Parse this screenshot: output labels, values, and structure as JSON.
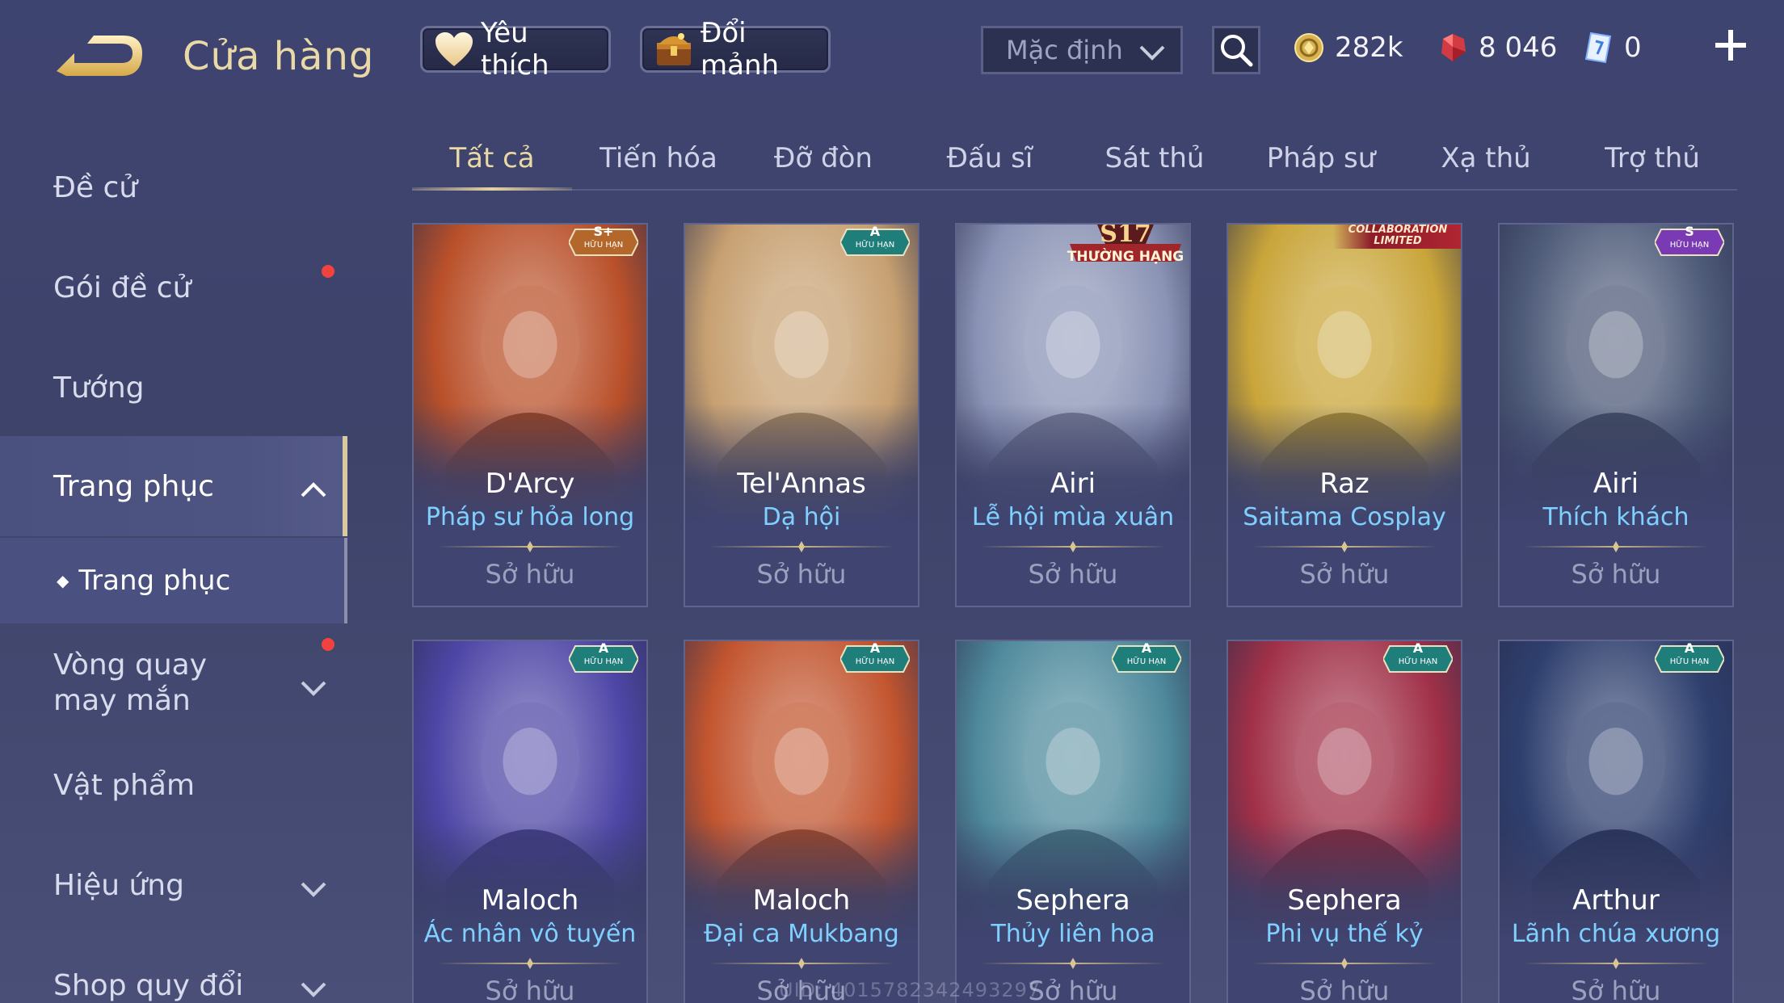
{
  "header": {
    "title": "Cửa hàng",
    "favorites_label": "Yêu thích",
    "exchange_label": "Đổi mảnh",
    "sort_selected": "Mặc định",
    "currency": {
      "gold": "282k",
      "ruby": "8 046",
      "voucher": "0"
    }
  },
  "sidebar": {
    "items": [
      {
        "label": "Đề cử"
      },
      {
        "label": "Gói đề cử"
      },
      {
        "label": "Tướng"
      },
      {
        "label": "Trang phục"
      },
      {
        "label": "Trang phục"
      },
      {
        "label": "Vòng quay may mắn"
      },
      {
        "label": "Vật phẩm"
      },
      {
        "label": "Hiệu ứng"
      },
      {
        "label": "Shop quy đổi"
      }
    ]
  },
  "tabs": [
    {
      "label": "Tất cả"
    },
    {
      "label": "Tiến hóa"
    },
    {
      "label": "Đỡ đòn"
    },
    {
      "label": "Đấu sĩ"
    },
    {
      "label": "Sát thủ"
    },
    {
      "label": "Pháp sư"
    },
    {
      "label": "Xạ thủ"
    },
    {
      "label": "Trợ thủ"
    }
  ],
  "cards": [
    {
      "hero": "D'Arcy",
      "skin": "Pháp sư hỏa long",
      "status": "Sở hữu",
      "badge": "S+",
      "badge_sub": "HỮU HẠN",
      "theme": "#b9502a"
    },
    {
      "hero": "Tel'Annas",
      "skin": "Dạ hội",
      "status": "Sở hữu",
      "badge": "A",
      "badge_sub": "HỮU HẠN",
      "theme": "#c7a071"
    },
    {
      "hero": "Airi",
      "skin": "Lễ hội mùa xuân",
      "status": "Sở hữu",
      "badge": "S17",
      "badge_sub": "THƯỜNG HẠNG",
      "theme": "#8a93b5"
    },
    {
      "hero": "Raz",
      "skin": "Saitama Cosplay",
      "status": "Sở hữu",
      "badge": "COLLABORATION",
      "badge_sub": "LIMITED",
      "theme": "#c9a53a"
    },
    {
      "hero": "Airi",
      "skin": "Thích khách",
      "status": "Sở hữu",
      "badge": "S",
      "badge_sub": "HỮU HẠN",
      "theme": "#4d5a78"
    },
    {
      "hero": "Maloch",
      "skin": "Ác nhân vô tuyến",
      "status": "Sở hữu",
      "badge": "A",
      "badge_sub": "HỮU HẠN",
      "theme": "#4e46a6"
    },
    {
      "hero": "Maloch",
      "skin": "Đại ca Mukbang",
      "status": "Sở hữu",
      "badge": "A",
      "badge_sub": "HỮU HẠN",
      "theme": "#c2552f"
    },
    {
      "hero": "Sephera",
      "skin": "Thủy liên hoa",
      "status": "Sở hữu",
      "badge": "A",
      "badge_sub": "HỮU HẠN",
      "theme": "#4f8a9c"
    },
    {
      "hero": "Sephera",
      "skin": "Phi vụ thế kỷ",
      "status": "Sở hữu",
      "badge": "A",
      "badge_sub": "HỮU HẠN",
      "theme": "#a03048"
    },
    {
      "hero": "Arthur",
      "skin": "Lãnh chúa xương",
      "status": "Sở hữu",
      "badge": "A",
      "badge_sub": "HỮU HẠN",
      "theme": "#2e3f6e"
    }
  ],
  "footer": {
    "uid": "UID: 4015782342493297"
  }
}
